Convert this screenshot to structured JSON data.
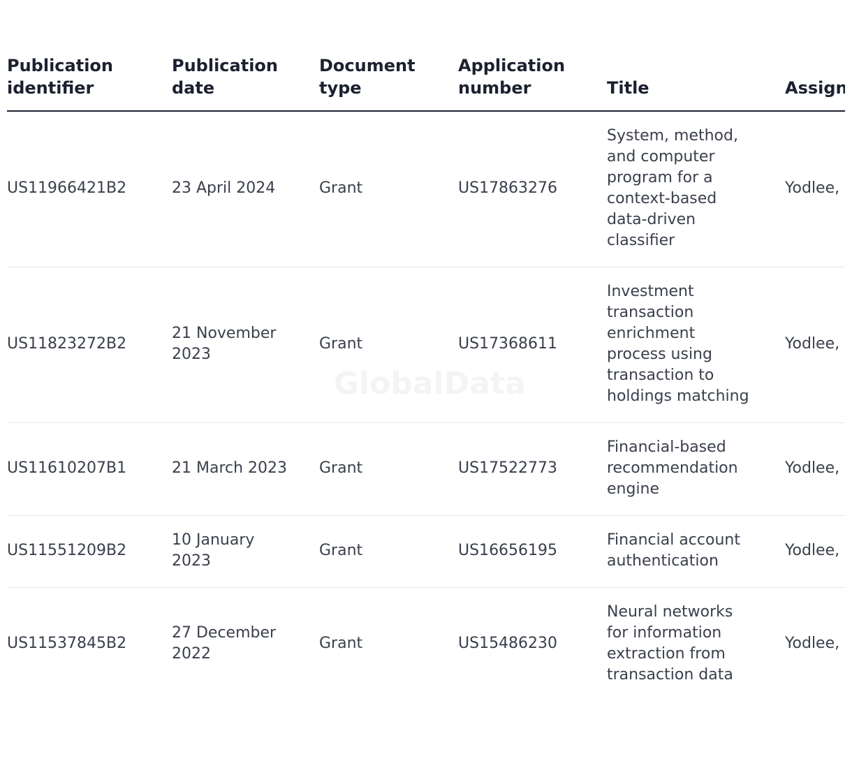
{
  "watermark": "GlobalData",
  "table": {
    "headers": [
      [
        "Publication",
        "identifier"
      ],
      [
        "Publication",
        "date"
      ],
      [
        "Document",
        "type"
      ],
      [
        "Application",
        "number"
      ],
      [
        "Title"
      ],
      [
        "Assignee"
      ]
    ],
    "rows": [
      {
        "id": "US11966421B2",
        "date": "23 April 2024",
        "type": "Grant",
        "app": "US17863276",
        "title": "System, method, and computer program for a context-based data-driven classifier",
        "assignee": "Yodlee, Inc."
      },
      {
        "id": "US11823272B2",
        "date": "21 November 2023",
        "type": "Grant",
        "app": "US17368611",
        "title": "Investment transaction enrichment process using transaction to holdings matching",
        "assignee": "Yodlee, Inc."
      },
      {
        "id": "US11610207B1",
        "date": "21 March 2023",
        "type": "Grant",
        "app": "US17522773",
        "title": "Financial-based recommendation engine",
        "assignee": "Yodlee, Inc."
      },
      {
        "id": "US11551209B2",
        "date": "10 January 2023",
        "type": "Grant",
        "app": "US16656195",
        "title": "Financial account authentication",
        "assignee": "Yodlee, Inc."
      },
      {
        "id": "US11537845B2",
        "date": "27 December 2022",
        "type": "Grant",
        "app": "US15486230",
        "title": "Neural networks for information extraction from transaction data",
        "assignee": "Yodlee, Inc."
      }
    ]
  }
}
